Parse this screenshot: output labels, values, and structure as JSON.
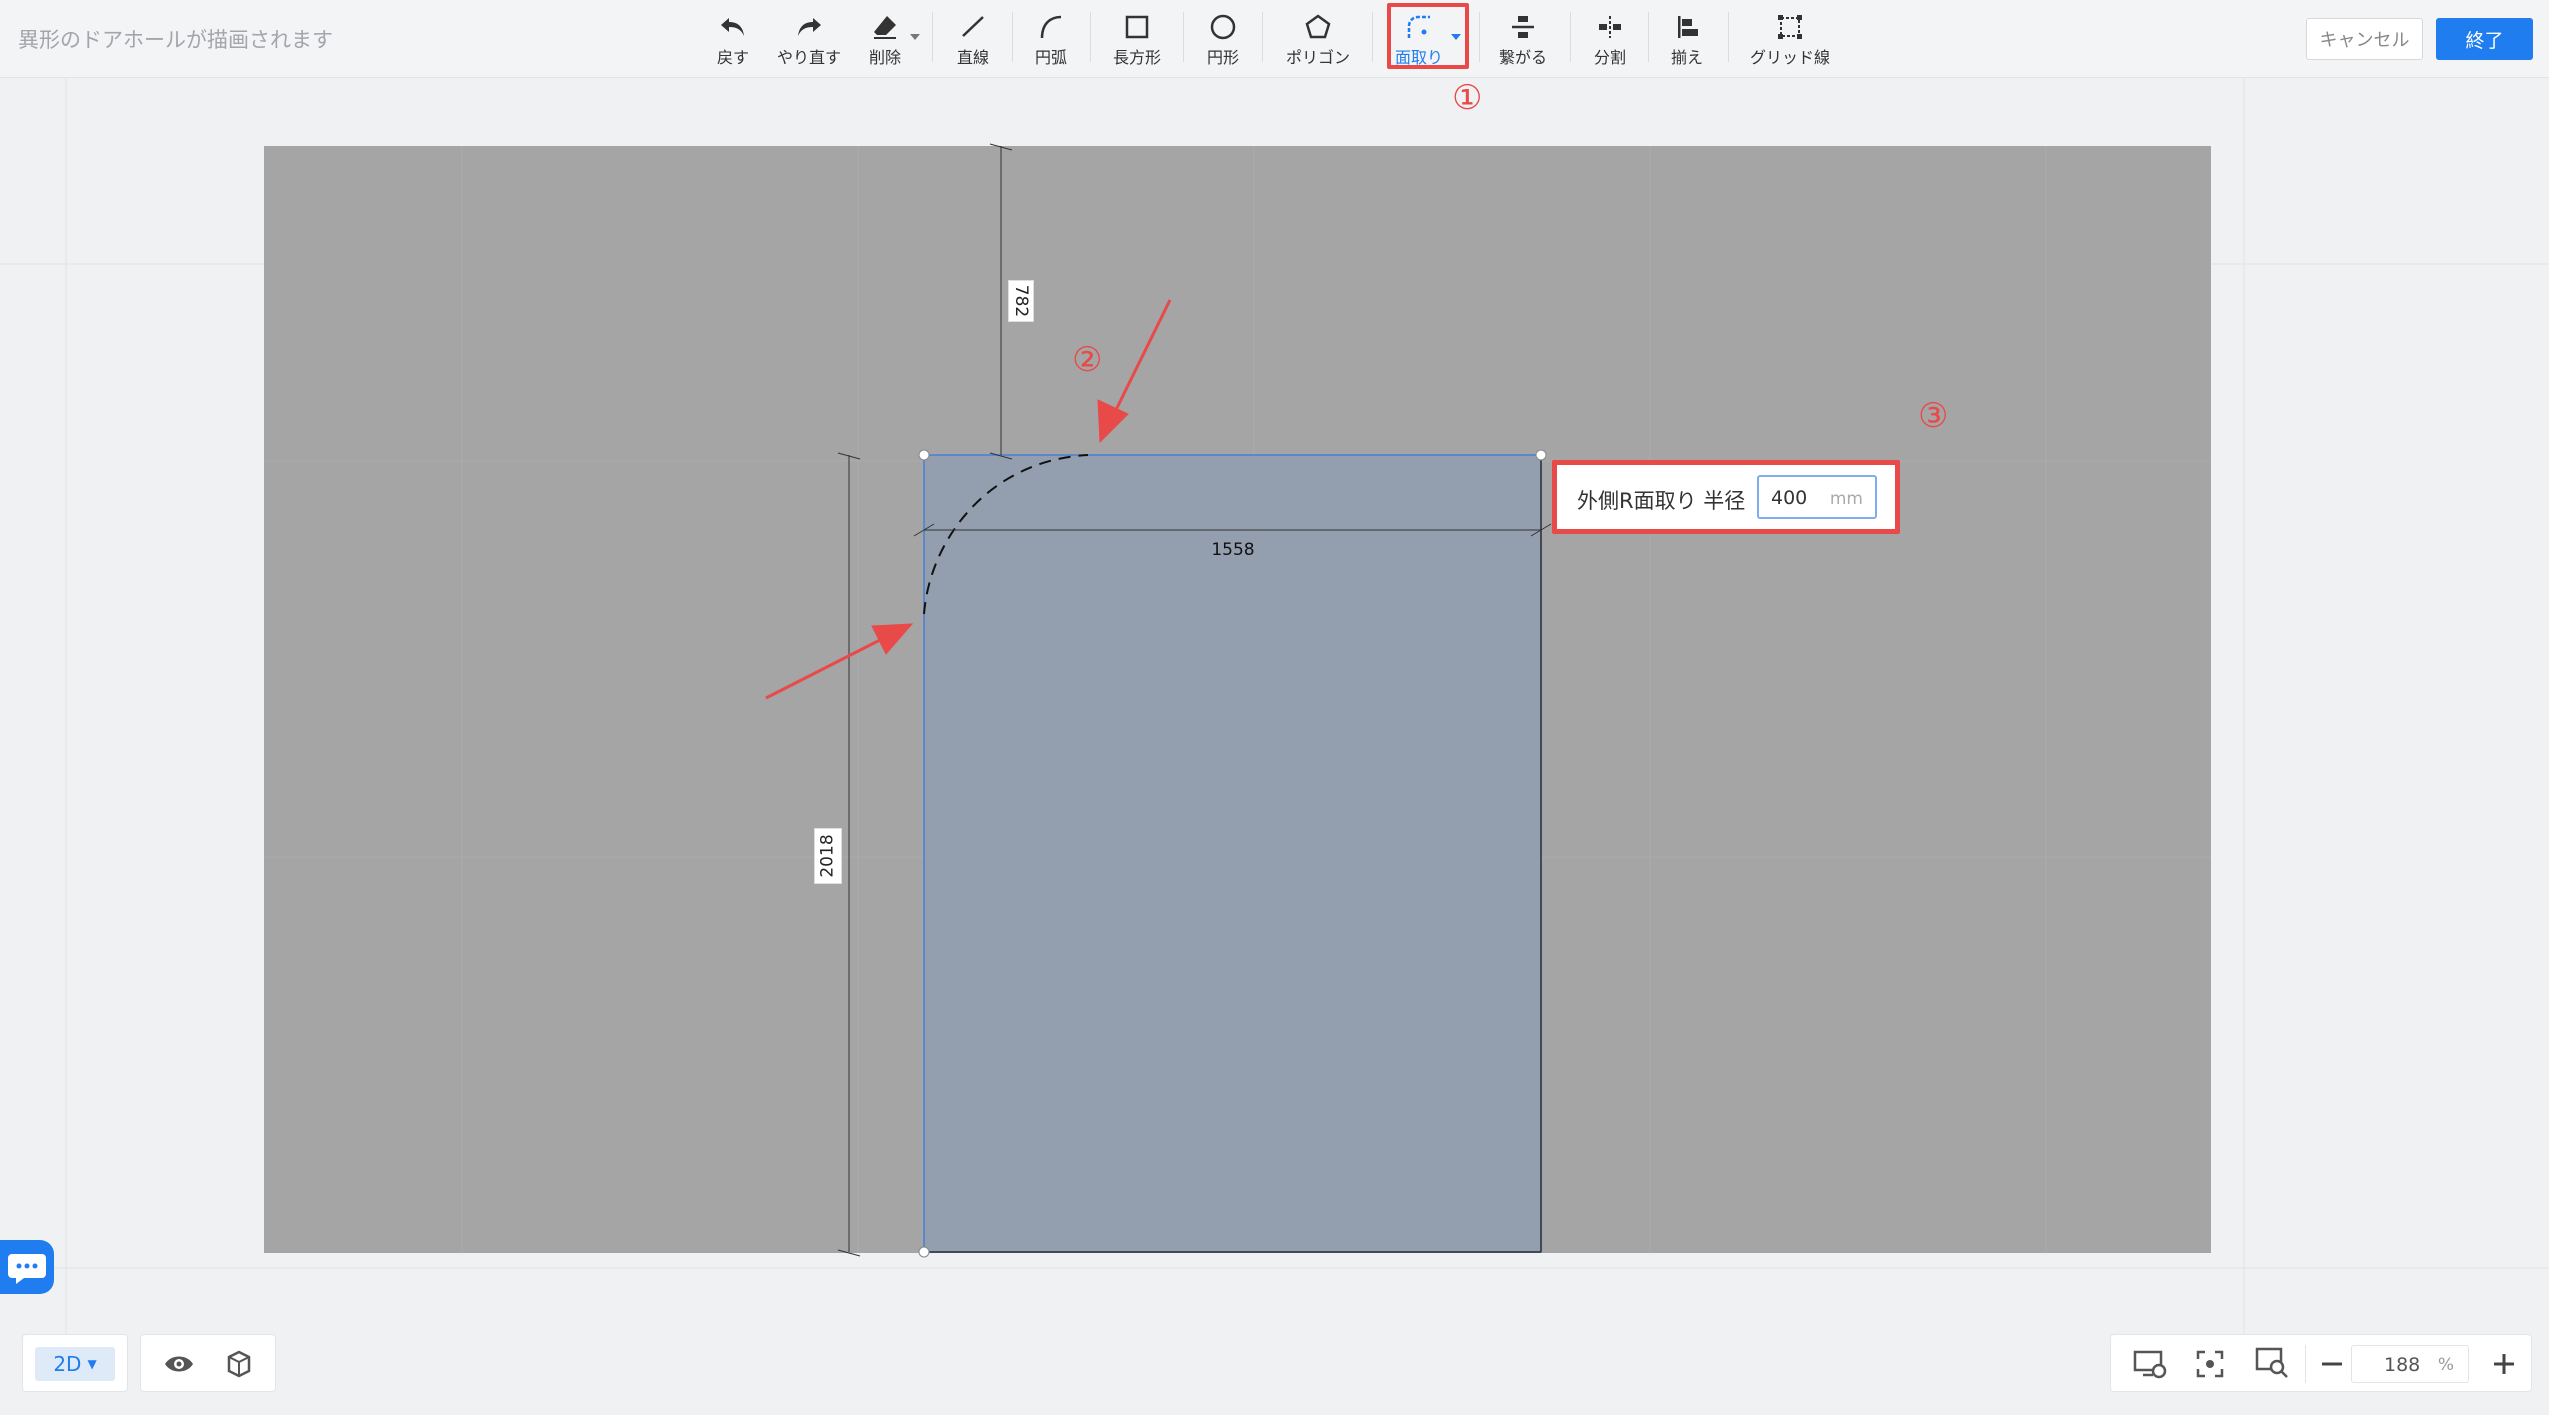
{
  "header": {
    "title": "異形のドアホールが描画されます",
    "cancel_label": "キャンセル",
    "finish_label": "終了"
  },
  "toolbar": {
    "undo": "戻す",
    "redo": "やり直す",
    "delete": "削除",
    "line": "直線",
    "arc": "円弧",
    "rectangle": "長方形",
    "circle": "円形",
    "polygon": "ポリゴン",
    "fillet": "面取り",
    "connect": "繋がる",
    "split": "分割",
    "align": "揃え",
    "gridline": "グリッド線"
  },
  "annotations": {
    "step1": "①",
    "step2": "②",
    "step3": "③"
  },
  "dimensions": {
    "top_offset": "782",
    "width": "1558",
    "height": "2018"
  },
  "fillet_popup": {
    "label": "外側R面取り 半径",
    "value": "400",
    "unit": "mm"
  },
  "bottom": {
    "mode": "2D",
    "zoom_value": "188",
    "zoom_unit": "%"
  },
  "colors": {
    "accent": "#1f7df0",
    "highlight": "#e84a4a",
    "wall": "#a5a5a5",
    "door": "#939faf"
  }
}
